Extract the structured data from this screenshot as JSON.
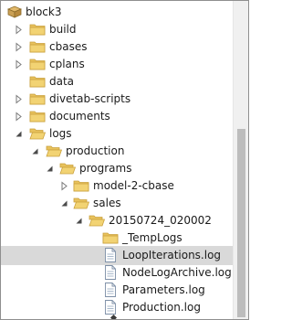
{
  "tree": {
    "root": {
      "label": "block3",
      "icon": "database-icon"
    },
    "items": [
      {
        "label": "build",
        "icon": "folder-icon",
        "expander": "collapsed"
      },
      {
        "label": "cbases",
        "icon": "folder-icon",
        "expander": "collapsed"
      },
      {
        "label": "cplans",
        "icon": "folder-icon",
        "expander": "collapsed"
      },
      {
        "label": "data",
        "icon": "folder-icon",
        "expander": "none"
      },
      {
        "label": "divetab-scripts",
        "icon": "folder-icon",
        "expander": "collapsed"
      },
      {
        "label": "documents",
        "icon": "folder-icon",
        "expander": "collapsed"
      },
      {
        "label": "logs",
        "icon": "folder-open-icon",
        "expander": "expanded"
      },
      {
        "label": "production",
        "icon": "folder-open-icon",
        "expander": "expanded"
      },
      {
        "label": "programs",
        "icon": "folder-open-icon",
        "expander": "expanded"
      },
      {
        "label": "model-2-cbase",
        "icon": "folder-icon",
        "expander": "collapsed"
      },
      {
        "label": "sales",
        "icon": "folder-open-icon",
        "expander": "expanded"
      },
      {
        "label": "20150724_020002",
        "icon": "folder-open-icon",
        "expander": "expanded"
      },
      {
        "label": "_TempLogs",
        "icon": "folder-icon",
        "expander": "none"
      },
      {
        "label": "LoopIterations.log",
        "icon": "file-icon",
        "expander": "none",
        "selected": true
      },
      {
        "label": "NodeLogArchive.log",
        "icon": "file-icon",
        "expander": "none"
      },
      {
        "label": "Parameters.log",
        "icon": "file-icon",
        "expander": "none"
      },
      {
        "label": "Production.log",
        "icon": "file-icon",
        "expander": "none"
      }
    ]
  },
  "colors": {
    "folder": "#e8c25c",
    "folder_dark": "#c9a03c",
    "selection": "#d9d9d9",
    "arrow": "#7a7a7a"
  }
}
